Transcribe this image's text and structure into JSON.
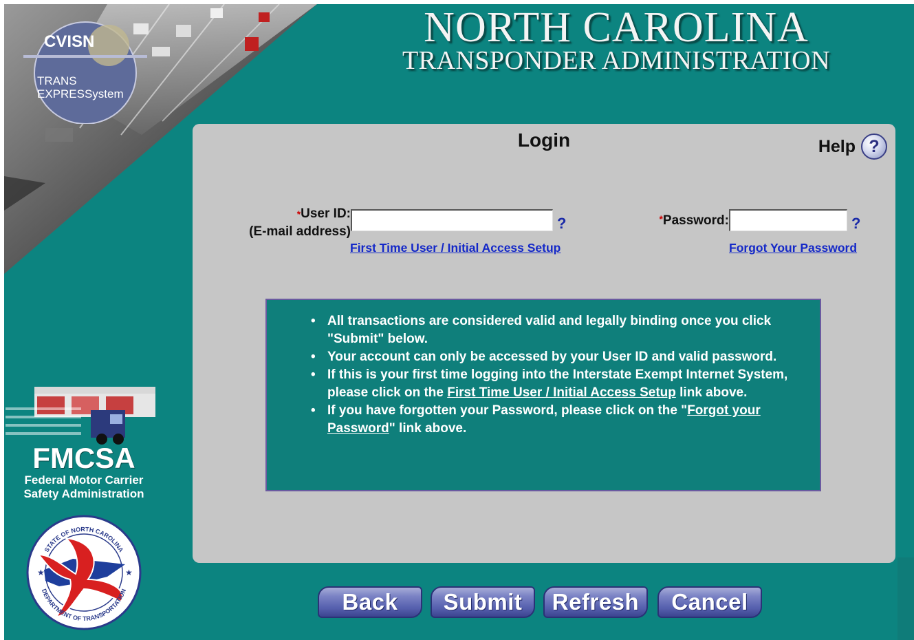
{
  "header": {
    "title": "NORTH CAROLINA",
    "subtitle": "TRANSPONDER ADMINISTRATION"
  },
  "logos": {
    "cvisn": {
      "name": "CVISN",
      "line1": "TRANS",
      "line2": "EXPRESSystem"
    },
    "fmcsa": {
      "name": "FMCSA",
      "sub1": "Federal Motor Carrier",
      "sub2": "Safety Administration"
    },
    "ncdot": {
      "top_text": "STATE OF NORTH CAROLINA",
      "bottom_text": "DEPARTMENT OF TRANSPORTATION"
    }
  },
  "login": {
    "title": "Login",
    "help_label": "Help",
    "help_icon": "?",
    "required_mark": "*",
    "user_id_label": "User ID:",
    "user_id_sublabel": "(E-mail address)",
    "user_id_value": "",
    "user_id_help": "?",
    "password_label": "Password:",
    "password_value": "",
    "password_help": "?",
    "first_time_link": "First Time User / Initial Access Setup",
    "forgot_link": "Forgot Your Password"
  },
  "info": {
    "b1_line1": "All transactions are considered valid and legally binding once you click",
    "b1_line2": "\"Submit\" below.",
    "b2": "Your account can only be accessed by your User ID and valid password.",
    "b3_pre": "If this is your first time logging into the Interstate Exempt Internet System, please click on the ",
    "b3_link": "First Time User / Initial Access Setup",
    "b3_post": " link above.",
    "b4_pre": "If you have forgotten your Password, please click on the \"",
    "b4_link": "Forgot your Password",
    "b4_post": "\" link above."
  },
  "buttons": {
    "back": "Back",
    "submit": "Submit",
    "refresh": "Refresh",
    "cancel": "Cancel"
  },
  "colors": {
    "background": "#0c8480",
    "panel": "#c6c6c6",
    "link": "#1428c8",
    "button": "#5660ae"
  }
}
